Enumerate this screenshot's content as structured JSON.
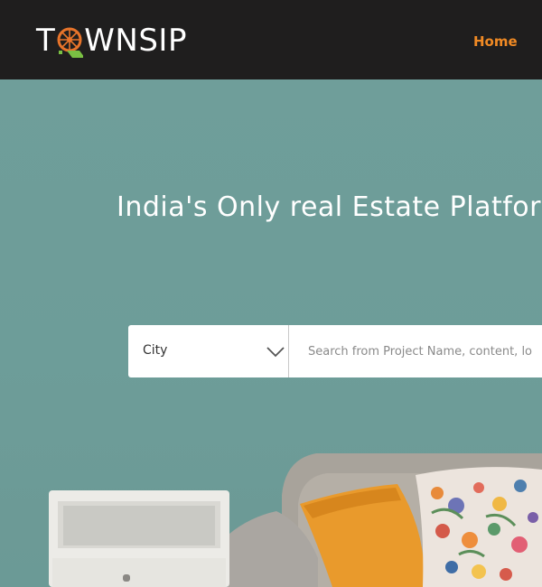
{
  "header": {
    "logo_text_left": "T",
    "logo_text_right": "WNSIP",
    "nav": {
      "home_label": "Home"
    }
  },
  "hero": {
    "title": "India's Only real Estate Platfor"
  },
  "search": {
    "city_label": "City",
    "placeholder": "Search from Project Name, content, lo"
  },
  "colors": {
    "header_bg": "#1f1e1e",
    "accent_orange": "#f08a24",
    "wall_teal": "#6e9d99",
    "logo_green": "#7ac043"
  },
  "icons": {
    "logo": "wheel-icon",
    "city_dropdown": "chevron-down-icon"
  }
}
